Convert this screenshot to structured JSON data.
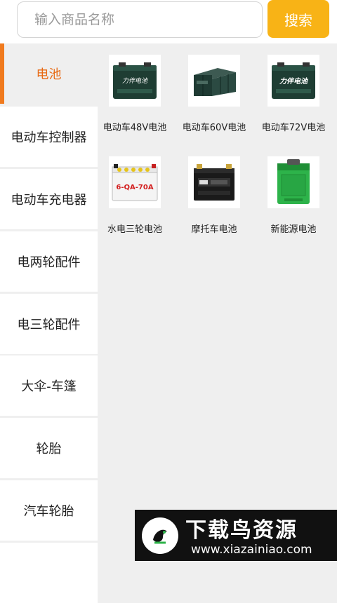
{
  "search": {
    "placeholder": "输入商品名称",
    "value": "",
    "button_label": "搜索"
  },
  "sidebar": {
    "active_index": 0,
    "items": [
      {
        "label": "电池"
      },
      {
        "label": "电动车控制器"
      },
      {
        "label": "电动车充电器"
      },
      {
        "label": "电两轮配件"
      },
      {
        "label": "电三轮配件"
      },
      {
        "label": "大伞-车篷"
      },
      {
        "label": "轮胎"
      },
      {
        "label": "汽车轮胎"
      }
    ]
  },
  "products": [
    {
      "name": "电动车48V电池",
      "label_text": "力伴电池"
    },
    {
      "name": "电动车60V电池",
      "label_text": ""
    },
    {
      "name": "电动车72V电池",
      "label_text": "力伴电池"
    },
    {
      "name": "水电三轮电池",
      "label_text": "6-QA-70A"
    },
    {
      "name": "摩托车电池",
      "label_text": ""
    },
    {
      "name": "新能源电池",
      "label_text": ""
    }
  ],
  "watermark": {
    "title": "下载鸟资源",
    "url": "www.xiazainiao.com"
  },
  "colors": {
    "accent_orange": "#f07a1e",
    "search_button": "#f8b316",
    "background": "#efefef"
  }
}
